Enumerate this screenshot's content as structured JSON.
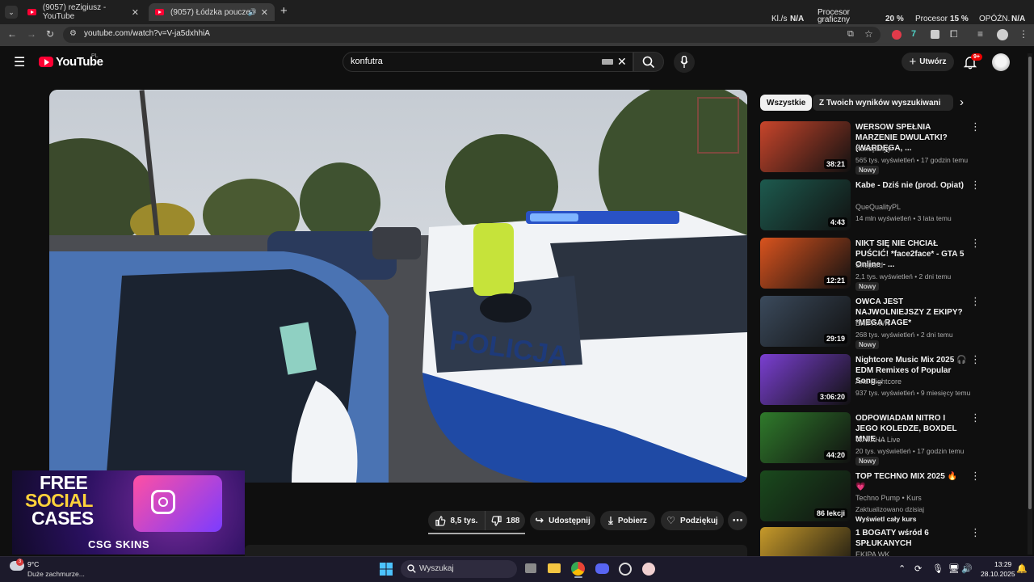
{
  "tabs": [
    {
      "label": "(9057) reZigiusz - YouTube"
    },
    {
      "label": "(9057) Łódzka pouczeniówk"
    }
  ],
  "perf": {
    "kls_label": "Kl./s",
    "kls_value": "N/A",
    "gpu_label_1": "Procesor",
    "gpu_label_2": "graficzny",
    "gpu_value": "20 %",
    "cpu_label": "Procesor",
    "cpu_value": "15 %",
    "lag_label": "OPÓŹN.",
    "lag_value": "N/A"
  },
  "address": {
    "url": "youtube.com/watch?v=V-ja5dxhhiA"
  },
  "youtube": {
    "logo_text": "YouTube",
    "region": "PL",
    "search_value": "konfutra",
    "create_label": "Utwórz",
    "notif_count": "9+"
  },
  "actions": {
    "like_count": "8,5 tys.",
    "dislike_count": "188",
    "share_label": "Udostępnij",
    "download_label": "Pobierz",
    "thanks_label": "Podziękuj"
  },
  "ad": {
    "line1": "FREE",
    "line2": "SOCIAL",
    "line3": "CASES",
    "brand": "CSG SKINS"
  },
  "chips": [
    {
      "label": "Wszystkie"
    },
    {
      "label": "Z Twoich wyników wyszukiwania"
    }
  ],
  "recommendations": [
    {
      "title": "WERSOW SPEŁNIA MARZENIE DWULATKI? (WARDĘGA, ...",
      "channel": "Konopskyy",
      "meta": "565 tys. wyświetleń • 17 godzin temu",
      "badge": "Nowy",
      "duration": "38:21",
      "thumb_color": "#c8452b"
    },
    {
      "title": "Kabe - Dziś nie (prod. Opiat)",
      "channel": "QueQualityPL",
      "meta": "14 mln wyświetleń • 3 lata temu",
      "badge": "",
      "duration": "4:43",
      "thumb_color": "#1d5a4e"
    },
    {
      "title": "NIKT SIĘ NIE CHCIAŁ PUŚCIĆ! *face2face* - GTA 5 Online - ...",
      "channel": "Shepard",
      "meta": "2,1 tys. wyświetleń • 2 dni temu",
      "badge": "Nowy",
      "duration": "12:21",
      "thumb_color": "#d9531e"
    },
    {
      "title": "OWCA JEST NAJWOLNIEJSZY Z EKIPY? *MEGA RAGE*",
      "channel": "EKIPA WK",
      "meta": "268 tys. wyświetleń • 2 dni temu",
      "badge": "Nowy",
      "duration": "29:19",
      "thumb_color": "#3b4a5c"
    },
    {
      "title": "Nightcore Music Mix 2025 🎧 EDM Remixes of Popular Song...",
      "channel": "Aria Nightcore",
      "meta": "937 tys. wyświetleń • 9 miesięcy temu",
      "badge": "",
      "duration": "3:06:20",
      "thumb_color": "#7a3fd1"
    },
    {
      "title": "ODPOWIADAM NITRO I JEGO KOLEDZE, BOXDEL MNIE ...",
      "channel": "WATAHA Live",
      "meta": "20 tys. wyświetleń • 17 godzin temu",
      "badge": "Nowy",
      "duration": "44:20",
      "thumb_color": "#2f7a2b"
    },
    {
      "title": "TOP TECHNO MIX 2025 🔥 💗",
      "channel": "Techno Pump • Kurs",
      "meta": "Zaktualizowano dzisiaj",
      "badge": "",
      "extra": "Wyświetl cały kurs",
      "duration": "86 lekcji",
      "thumb_color": "#1a4a1d"
    },
    {
      "title": "1 BOGATY wśród 6 SPŁUKANYCH",
      "channel": "EKIPA WK",
      "meta": "",
      "badge": "",
      "duration": "",
      "thumb_color": "#c79a2a"
    }
  ],
  "taskbar": {
    "weather_temp": "9°C",
    "weather_desc": "Duże zachmurze...",
    "search_label": "Wyszukaj",
    "time": "13:29",
    "date": "28.10.2025"
  }
}
